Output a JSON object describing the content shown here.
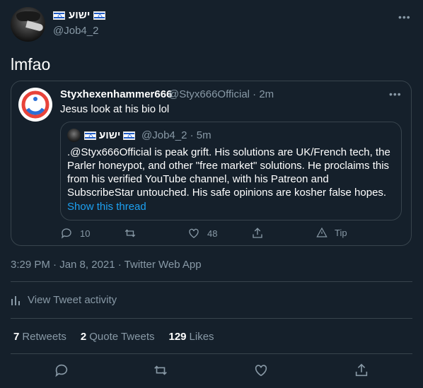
{
  "author": {
    "display_name": "ישוע",
    "handle": "@Job4_2",
    "flag_icon": "israel-flag-icon"
  },
  "tweet": {
    "text": "lmfao",
    "timestamp": "3:29 PM · Jan 8, 2021 · Twitter Web App"
  },
  "quoted": {
    "display_name": "Styxhexenhammer666",
    "handle_time": "@Styx666Official · 2m",
    "text": "Jesus look at his bio lol",
    "inner": {
      "display_name": "ישוע",
      "handle_time": "@Job4_2 · 5m",
      "body": ".@Styx666Official is peak grift. His solutions are UK/French tech, the Parler honeypot, and other \"free market\" solutions. He proclaims this from his verified YouTube channel, with his Patreon and SubscribeStar untouched. His safe opinions are kosher false hopes.",
      "show_thread": "Show this thread"
    },
    "actions": {
      "replies": "10",
      "likes": "48",
      "tip": "Tip"
    }
  },
  "activity": {
    "label": "View Tweet activity"
  },
  "stats": {
    "retweets_count": "7",
    "retweets_label": "Retweets",
    "quotes_count": "2",
    "quotes_label": "Quote Tweets",
    "likes_count": "129",
    "likes_label": "Likes"
  },
  "colors": {
    "background": "#15202b",
    "border": "#38444d",
    "muted": "#8899a6",
    "link": "#1da1f2"
  }
}
